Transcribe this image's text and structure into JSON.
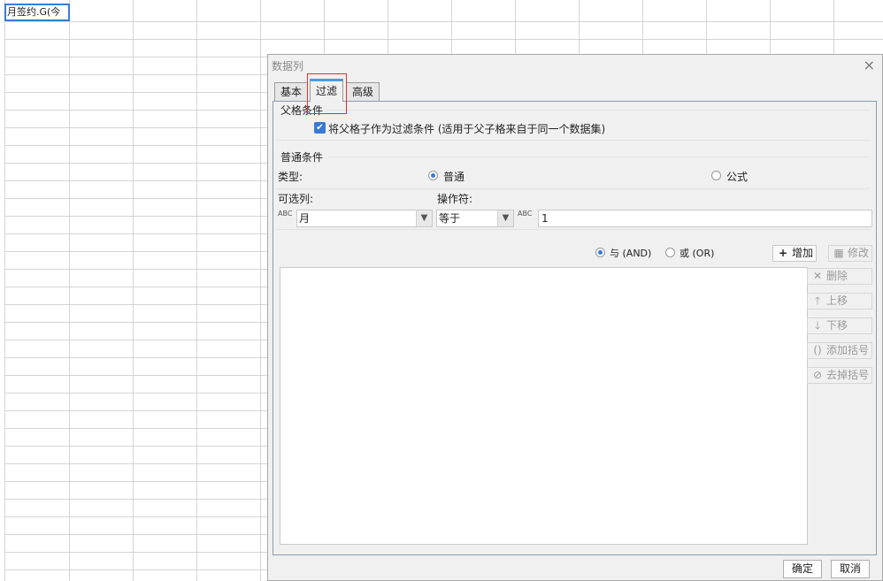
{
  "spreadsheet": {
    "a1_value": "月签约.G(今"
  },
  "dialog": {
    "title": "数据列",
    "close_glyph": "×",
    "tabs": [
      {
        "label": "基本"
      },
      {
        "label": "过滤"
      },
      {
        "label": "高级"
      }
    ],
    "parent_section": {
      "title": "父格条件",
      "checkbox_label": "将父格子作为过滤条件 (适用于父子格来自于同一个数据集)",
      "checked": true
    },
    "normal_section": {
      "title": "普通条件",
      "type_label": "类型:",
      "type_options": [
        {
          "label": "普通",
          "selected": true
        },
        {
          "label": "公式",
          "selected": false
        }
      ],
      "column_label": "可选列:",
      "operator_label": "操作符:",
      "column_value": "月",
      "operator_value": "等于",
      "abc_icon_text": "ABC",
      "value": "1"
    },
    "logic": [
      {
        "label": "与 (AND)",
        "selected": true
      },
      {
        "label": "或 (OR)",
        "selected": false
      }
    ],
    "buttons": {
      "add": "增加",
      "modify": "修改",
      "delete": "删除",
      "move_up": "上移",
      "move_down": "下移",
      "add_bracket": "添加括号",
      "remove_bracket": "去掉括号"
    },
    "footer": {
      "ok": "确定",
      "cancel": "取消"
    }
  },
  "colors": {
    "accent": "#3a78d4",
    "tab_highlight": "#e03030",
    "grid": "#d4d4d4"
  }
}
